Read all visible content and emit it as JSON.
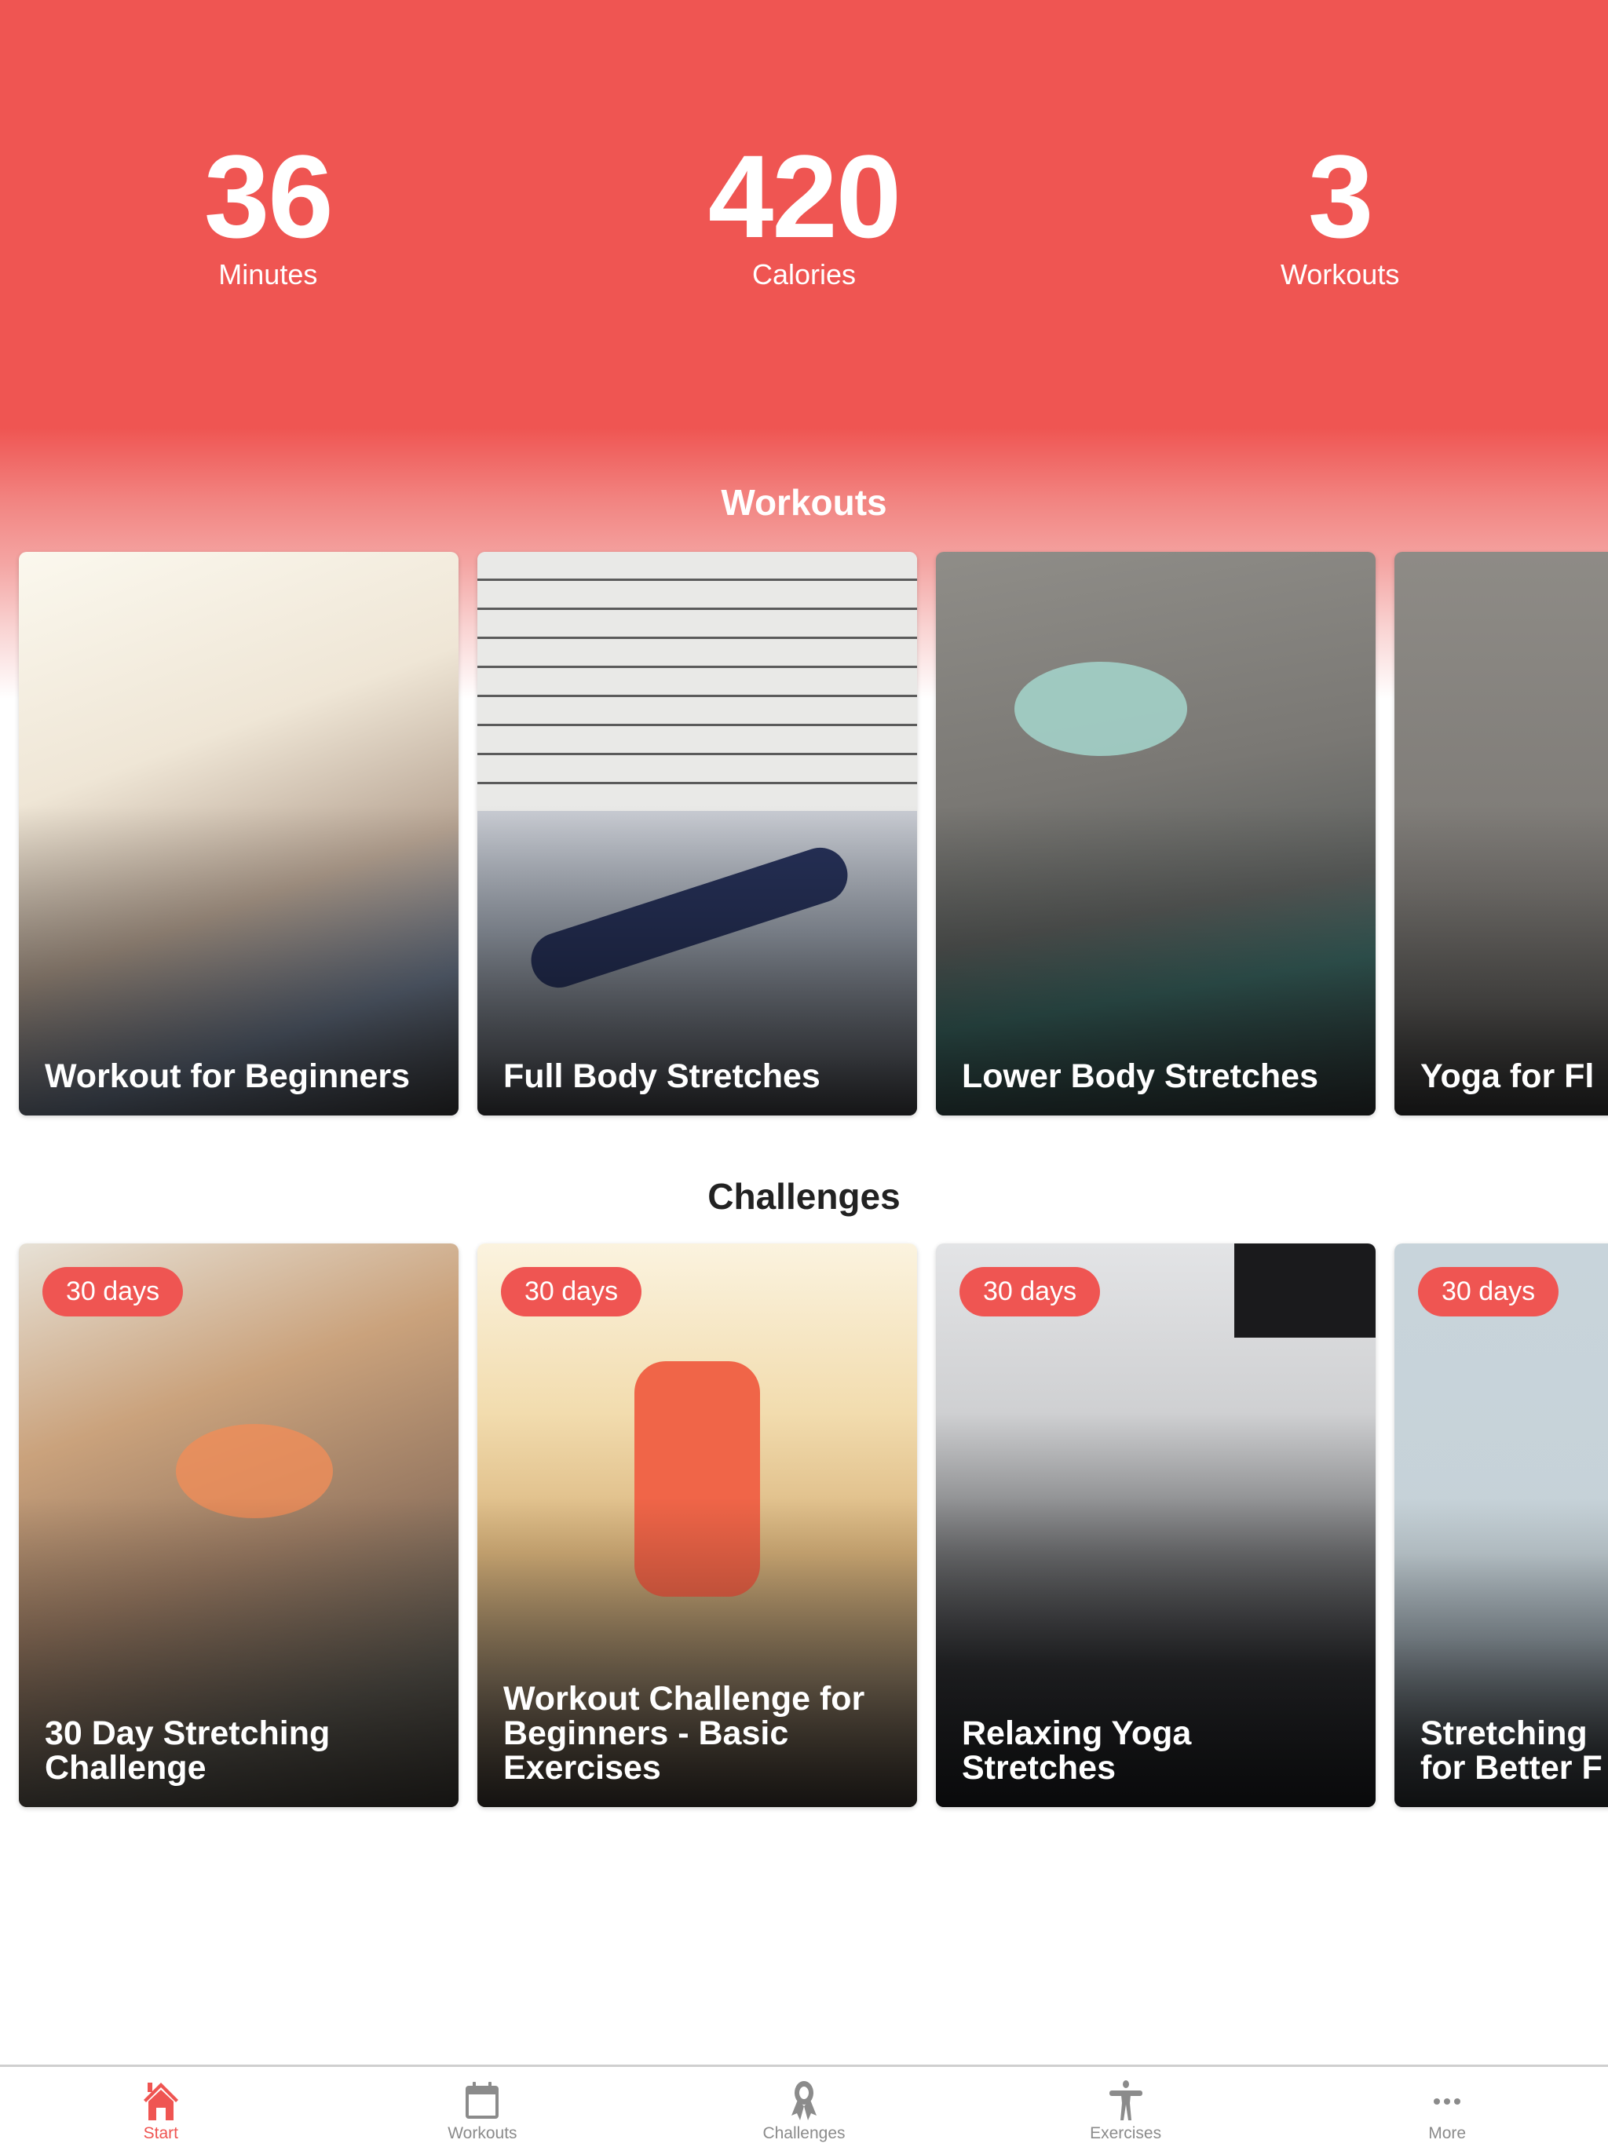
{
  "theme": {
    "accent": "#EF5552",
    "tab_inactive": "#8B8B8B"
  },
  "stats": [
    {
      "value": "36",
      "label": "Minutes"
    },
    {
      "value": "420",
      "label": "Calories"
    },
    {
      "value": "3",
      "label": "Workouts"
    }
  ],
  "workouts": {
    "title": "Workouts",
    "items": [
      {
        "title": "Workout for Beginners"
      },
      {
        "title": "Full Body Stretches"
      },
      {
        "title": "Lower Body Stretches"
      },
      {
        "title": "Yoga for Fl"
      }
    ]
  },
  "challenges": {
    "title": "Challenges",
    "items": [
      {
        "badge": "30 days",
        "title": "30 Day Stretching Challenge"
      },
      {
        "badge": "30 days",
        "title": "Workout Challenge for Beginners - Basic Exercises"
      },
      {
        "badge": "30 days",
        "title": "Relaxing Yoga Stretches"
      },
      {
        "badge": "30 days",
        "title": "Stretching for Better F"
      }
    ]
  },
  "tabbar": {
    "items": [
      {
        "label": "Start",
        "icon": "home-icon",
        "active": true
      },
      {
        "label": "Workouts",
        "icon": "calendar-icon",
        "active": false
      },
      {
        "label": "Challenges",
        "icon": "award-ribbon-icon",
        "active": false
      },
      {
        "label": "Exercises",
        "icon": "person-figure-icon",
        "active": false
      },
      {
        "label": "More",
        "icon": "more-dots-icon",
        "active": false
      }
    ]
  }
}
